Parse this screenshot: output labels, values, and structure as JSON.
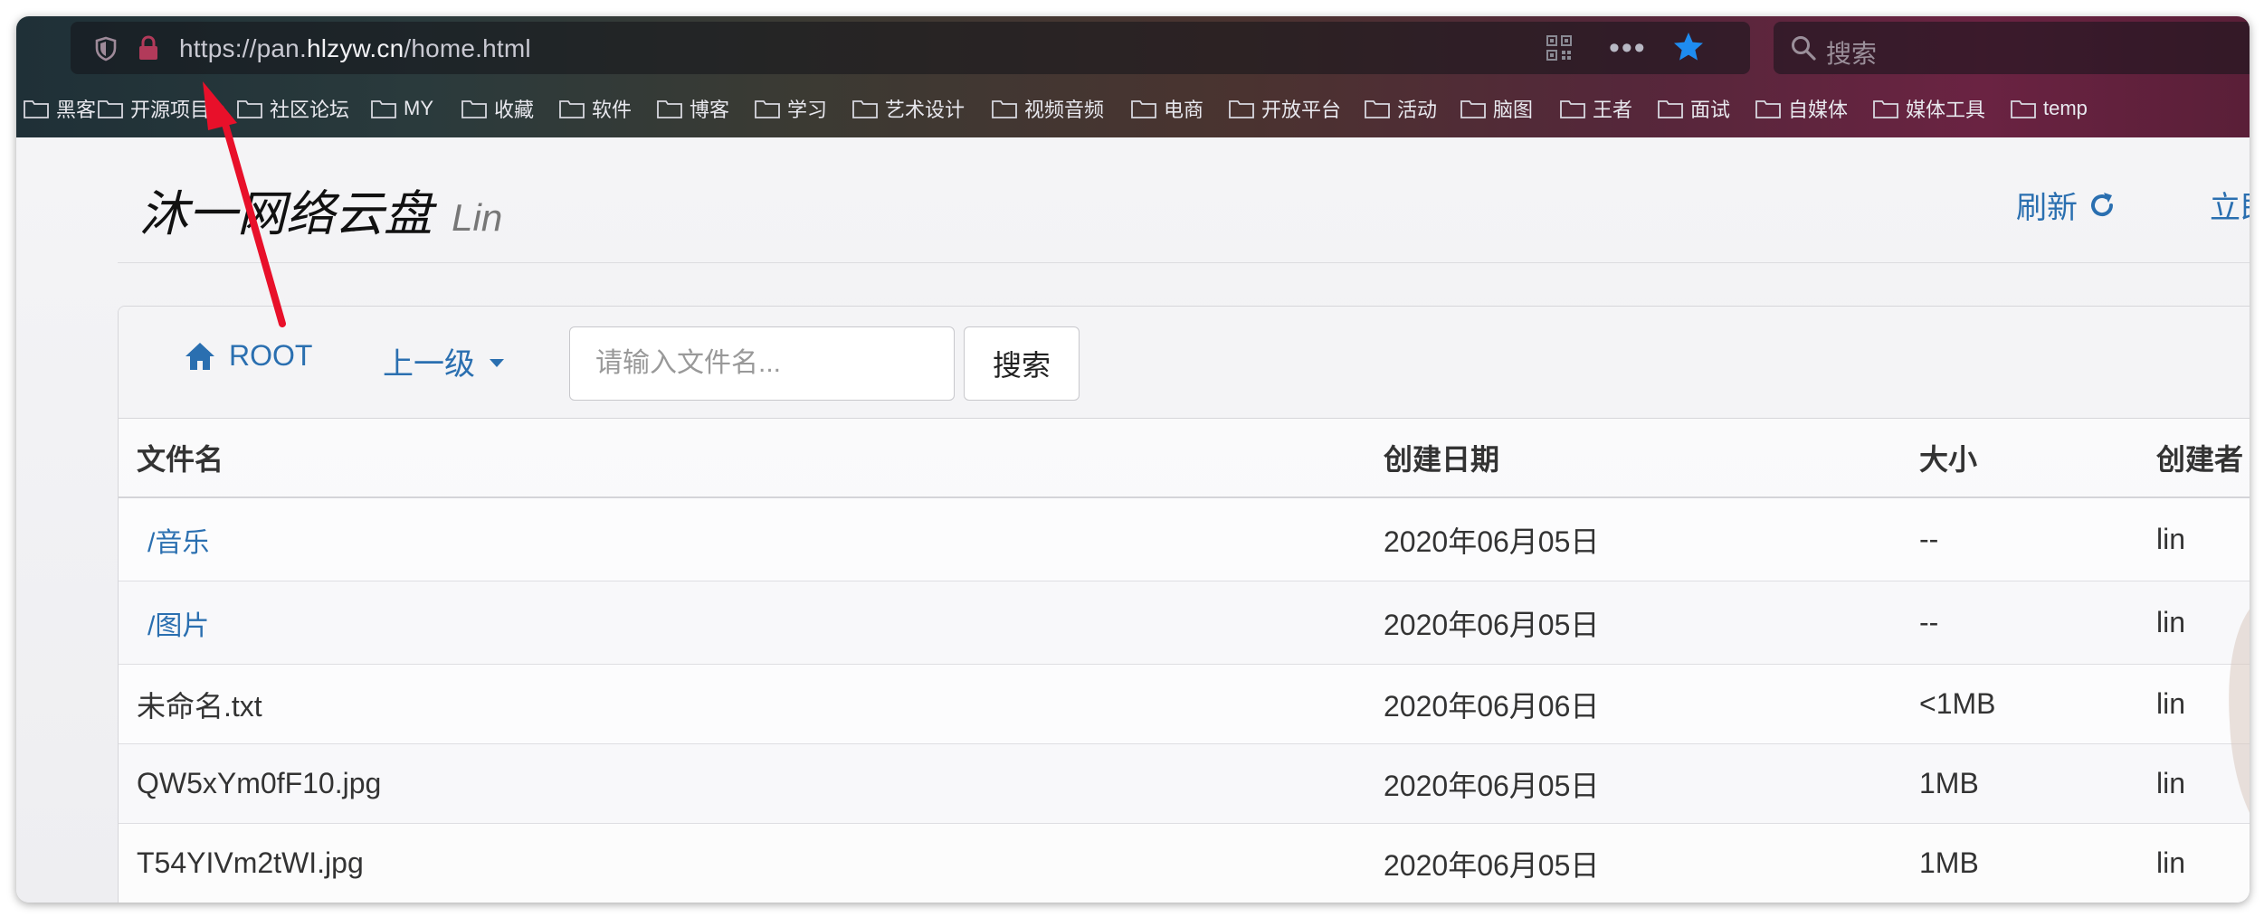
{
  "browser": {
    "url_prefix": "https://pan.",
    "url_domain": "hlzyw.cn",
    "url_path": "/home.html",
    "search_placeholder": "搜索",
    "bookmarks": [
      "黑客",
      "开源项目",
      "社区论坛",
      "MY",
      "收藏",
      "软件",
      "博客",
      "学习",
      "艺术设计",
      "视频音频",
      "电商",
      "开放平台",
      "活动",
      "脑图",
      "王者",
      "面试",
      "自媒体",
      "媒体工具",
      "temp"
    ]
  },
  "header": {
    "brand": "沐一网络云盘",
    "brand_sub": "Lin",
    "refresh_label": "刷新",
    "clipped_link": "立即"
  },
  "toolbar": {
    "root_label": "ROOT",
    "up_label": "上一级",
    "search_placeholder": "请输入文件名...",
    "search_button": "搜索"
  },
  "table": {
    "columns": [
      "文件名",
      "创建日期",
      "大小",
      "创建者"
    ],
    "rows": [
      {
        "name": "/音乐",
        "is_dir": true,
        "date": "2020年06月05日",
        "size": "--",
        "owner": "lin"
      },
      {
        "name": "/图片",
        "is_dir": true,
        "date": "2020年06月05日",
        "size": "--",
        "owner": "lin"
      },
      {
        "name": "未命名.txt",
        "is_dir": false,
        "date": "2020年06月06日",
        "size": "<1MB",
        "owner": "lin"
      },
      {
        "name": "QW5xYm0fF10.jpg",
        "is_dir": false,
        "date": "2020年06月05日",
        "size": "1MB",
        "owner": "lin"
      },
      {
        "name": "T54YIVm2tWI.jpg",
        "is_dir": false,
        "date": "2020年06月05日",
        "size": "1MB",
        "owner": "lin"
      }
    ]
  },
  "colors": {
    "link": "#2a6fb0",
    "annotation_arrow": "#e8102a",
    "star": "#1e8cf0"
  }
}
